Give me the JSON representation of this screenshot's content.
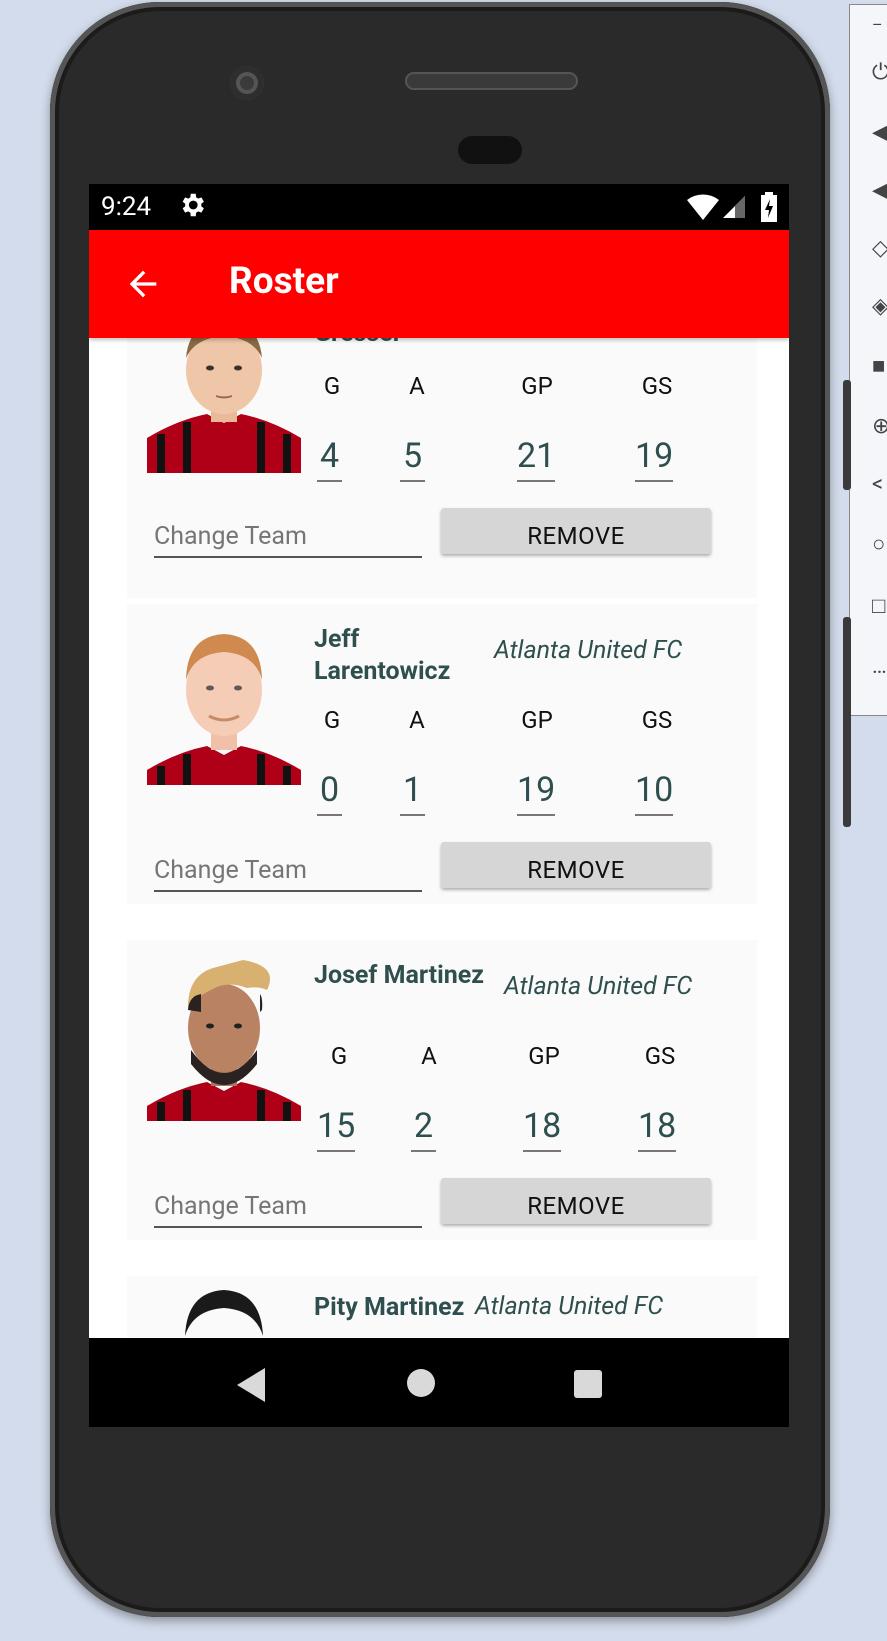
{
  "status_bar": {
    "time": "9:24"
  },
  "app_bar": {
    "title": "Roster"
  },
  "stat_headers": [
    "G",
    "A",
    "GP",
    "GS"
  ],
  "players": [
    {
      "name": "Gressel",
      "team": "",
      "g": "4",
      "a": "5",
      "gp": "21",
      "gs": "19",
      "change_placeholder": "Change Team",
      "remove_label": "REMOVE"
    },
    {
      "name": "Jeff Larentowicz",
      "team": "Atlanta United FC",
      "g": "0",
      "a": "1",
      "gp": "19",
      "gs": "10",
      "change_placeholder": "Change Team",
      "remove_label": "REMOVE"
    },
    {
      "name": "Josef Martinez",
      "team": "Atlanta United FC",
      "g": "15",
      "a": "2",
      "gp": "18",
      "gs": "18",
      "change_placeholder": "Change Team",
      "remove_label": "REMOVE"
    },
    {
      "name": "Pity Martinez",
      "team": "Atlanta United FC"
    }
  ],
  "colors": {
    "app_bar": "#ff0000",
    "text_primary": "#2f4f4f",
    "button_bg": "#d6d6d6"
  }
}
